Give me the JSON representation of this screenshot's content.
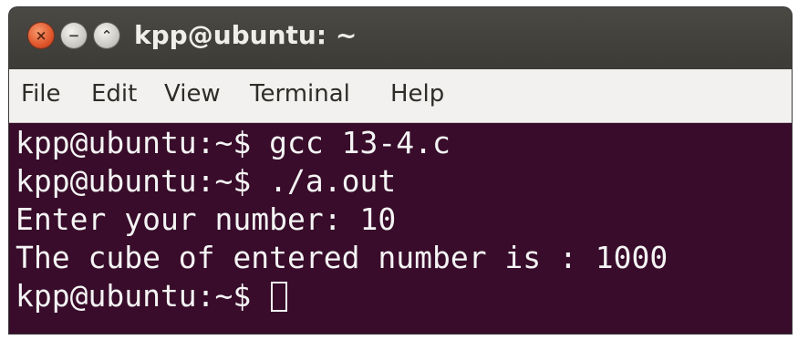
{
  "window": {
    "title": "kpp@ubuntu: ~",
    "buttons": {
      "close_glyph": "×",
      "minimize_glyph": "−",
      "maximize_glyph": "⌃"
    }
  },
  "menu": {
    "items": [
      "File",
      "Edit",
      "View",
      "Terminal",
      "Help"
    ]
  },
  "terminal": {
    "background": "#380c2a",
    "foreground": "#f4f4f4",
    "lines": [
      "kpp@ubuntu:~$ gcc 13-4.c",
      "kpp@ubuntu:~$ ./a.out",
      "Enter your number: 10",
      "The cube of entered number is : 1000"
    ],
    "prompt": "kpp@ubuntu:~$ "
  }
}
